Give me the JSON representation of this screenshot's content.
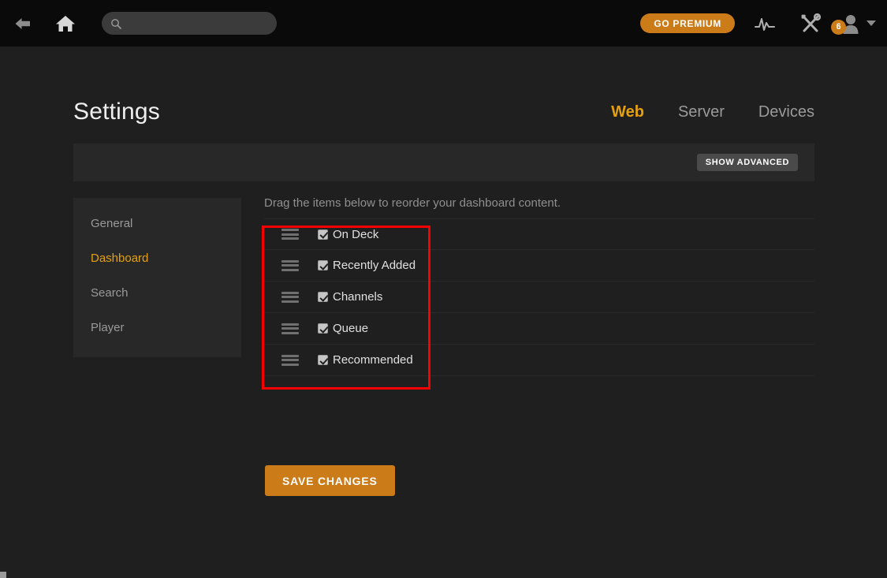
{
  "topbar": {
    "back_icon": "arrow-left-icon",
    "home_icon": "home-icon",
    "search_placeholder": "",
    "search_value": "",
    "search_icon": "search-icon",
    "go_premium_label": "GO PREMIUM",
    "activity_icon": "pulse-activity-icon",
    "tools_icon": "wrench-screwdriver-icon",
    "avatar_icon": "user-avatar-icon",
    "avatar_badge_count": "6",
    "caret_icon": "chevron-down-icon"
  },
  "header": {
    "title": "Settings",
    "tabs": [
      {
        "label": "Web",
        "active": true
      },
      {
        "label": "Server",
        "active": false
      },
      {
        "label": "Devices",
        "active": false
      }
    ]
  },
  "toolbar": {
    "show_advanced_label": "SHOW ADVANCED"
  },
  "sidebar": {
    "items": [
      {
        "label": "General",
        "active": false
      },
      {
        "label": "Dashboard",
        "active": true
      },
      {
        "label": "Search",
        "active": false
      },
      {
        "label": "Player",
        "active": false
      }
    ]
  },
  "panel": {
    "description": "Drag the items below to reorder your dashboard content.",
    "rows": [
      {
        "label": "On Deck",
        "checked": true,
        "handle_icon": "drag-handle-icon"
      },
      {
        "label": "Recently Added",
        "checked": true,
        "handle_icon": "drag-handle-icon"
      },
      {
        "label": "Channels",
        "checked": true,
        "handle_icon": "drag-handle-icon"
      },
      {
        "label": "Queue",
        "checked": true,
        "handle_icon": "drag-handle-icon"
      },
      {
        "label": "Recommended",
        "checked": true,
        "handle_icon": "drag-handle-icon"
      }
    ],
    "save_label": "SAVE CHANGES"
  },
  "colors": {
    "accent_orange": "#cc7b19",
    "active_gold": "#e5a00d",
    "page_bg": "#1f1f1f",
    "panel_bg": "#282828",
    "topbar_bg": "#0a0a0a",
    "annotation_red": "#f70000"
  }
}
